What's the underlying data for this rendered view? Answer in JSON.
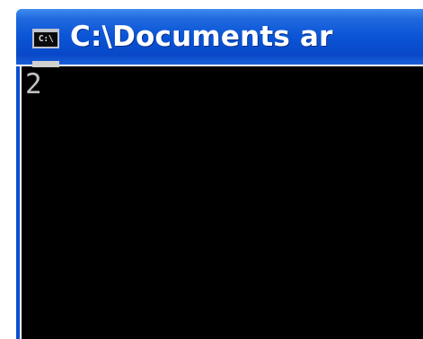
{
  "window": {
    "title": "C:\\Documents ar",
    "icon": "console-window-icon",
    "icon_glyph": "C:\\"
  },
  "console": {
    "text": "2",
    "cursor": "blinking-underscore-cursor"
  },
  "colors": {
    "titlebar_blue": "#0a55d6",
    "console_bg": "#000000",
    "console_text": "#c0c0c0"
  }
}
